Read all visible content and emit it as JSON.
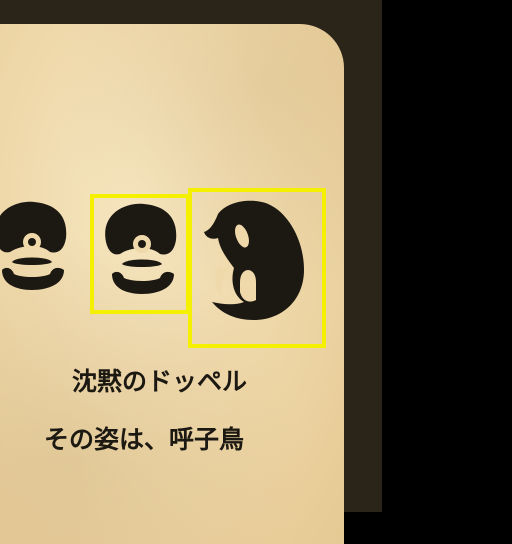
{
  "card": {
    "title": "沈黙のドッペル",
    "subtitle": "その姿は、呼子鳥"
  },
  "glyph_icons": [
    "face-glyph-icon",
    "face-glyph-icon",
    "bird-glyph-icon"
  ],
  "colors": {
    "highlight": "#f4f000",
    "ink": "#1c1812",
    "parchment": "#efd9ab",
    "frame": "#2a2419"
  }
}
